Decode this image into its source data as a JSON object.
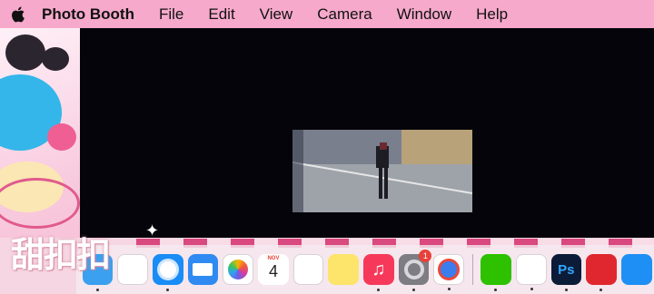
{
  "menubar": {
    "apple_icon": "apple-logo-icon",
    "items": [
      "Photo Booth",
      "File",
      "Edit",
      "View",
      "Camera",
      "Window",
      "Help"
    ]
  },
  "wallpaper": {
    "sticker_text": "甜扣扣"
  },
  "dock": {
    "apps": [
      {
        "name": "finder",
        "icon": "finder-icon",
        "color": "#3aa0ef",
        "running": true
      },
      {
        "name": "launchpad",
        "icon": "launchpad-icon",
        "color": "#ffffff",
        "running": false
      },
      {
        "name": "safari",
        "icon": "safari-icon",
        "color": "#1a8cf5",
        "running": true
      },
      {
        "name": "mail",
        "icon": "mail-icon",
        "color": "#2f8bf2",
        "running": false
      },
      {
        "name": "photos",
        "icon": "photos-icon",
        "color": "#ffffff",
        "running": false
      },
      {
        "name": "calendar",
        "icon": "calendar-icon",
        "color": "#ffffff",
        "running": false,
        "month": "NOV",
        "day": "4"
      },
      {
        "name": "reminders",
        "icon": "reminders-icon",
        "color": "#ffffff",
        "running": false
      },
      {
        "name": "notes",
        "icon": "notes-icon",
        "color": "#fde46b",
        "running": false
      },
      {
        "name": "music",
        "icon": "music-icon",
        "color": "#f6395a",
        "running": true
      },
      {
        "name": "system-preferences",
        "icon": "gear-icon",
        "color": "#7d7d83",
        "running": true,
        "badge": "1"
      },
      {
        "name": "chrome",
        "icon": "chrome-icon",
        "color": "#ffffff",
        "running": true
      },
      {
        "name": "wechat",
        "icon": "wechat-icon",
        "color": "#2dc100",
        "running": true
      },
      {
        "name": "qq",
        "icon": "qq-penguin-icon",
        "color": "#ffffff",
        "running": true
      },
      {
        "name": "photoshop",
        "icon": "photoshop-icon",
        "color": "#0b1b38",
        "running": true,
        "label": "Ps"
      },
      {
        "name": "netease-music",
        "icon": "netease-music-icon",
        "color": "#e0262f",
        "running": true
      },
      {
        "name": "app-store",
        "icon": "app-store-icon",
        "color": "#1e8ff5",
        "running": false
      }
    ]
  }
}
